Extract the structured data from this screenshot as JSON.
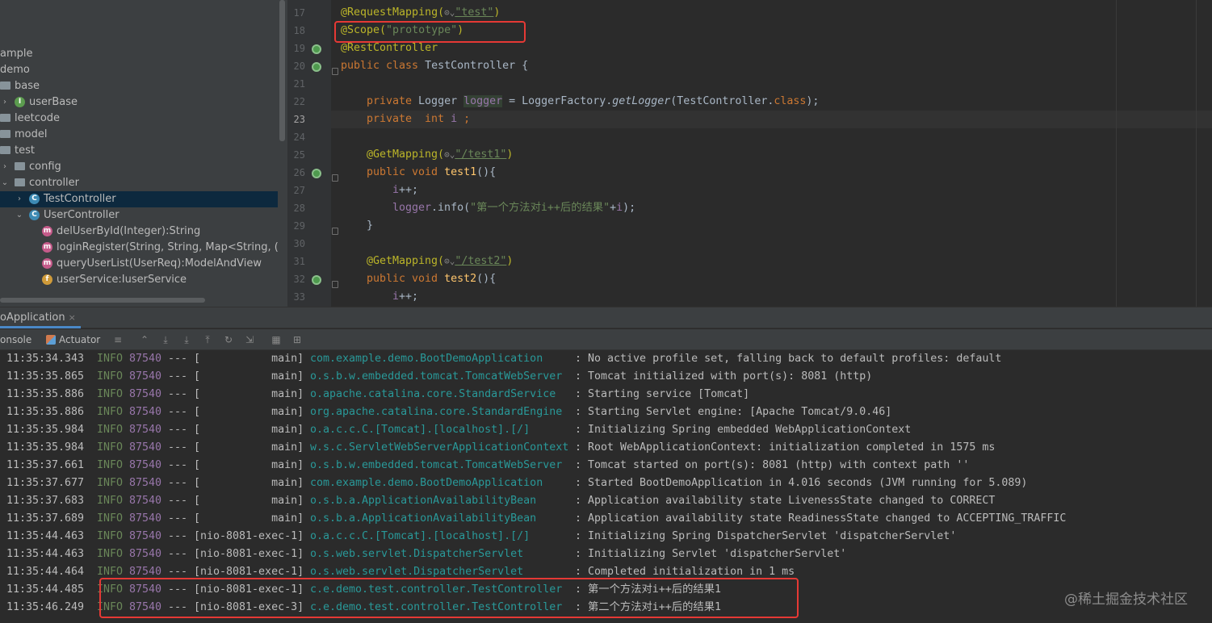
{
  "project_tree": {
    "items": [
      {
        "label": "ample",
        "icon": "none",
        "arrow": ""
      },
      {
        "label": "demo",
        "icon": "none",
        "arrow": ""
      },
      {
        "label": "base",
        "icon": "folder-icon",
        "arrow": ""
      },
      {
        "label": "userBase",
        "icon": "interface-icon",
        "arrow": "›"
      },
      {
        "label": "leetcode",
        "icon": "folder-icon",
        "arrow": ""
      },
      {
        "label": "model",
        "icon": "folder-icon",
        "arrow": ""
      },
      {
        "label": "test",
        "icon": "folder-icon",
        "arrow": ""
      },
      {
        "label": "config",
        "icon": "folder-icon",
        "arrow": "›"
      },
      {
        "label": "controller",
        "icon": "folder-icon",
        "arrow": "⌄"
      },
      {
        "label": "TestController",
        "icon": "class-icon",
        "arrow": "›"
      },
      {
        "label": "UserController",
        "icon": "class-icon",
        "arrow": "⌄"
      },
      {
        "label": "delUserById(Integer):String",
        "icon": "method-icon",
        "arrow": ""
      },
      {
        "label": "loginRegister(String, String, Map<String, (",
        "icon": "method-icon",
        "arrow": ""
      },
      {
        "label": "queryUserList(UserReq):ModelAndView",
        "icon": "method-icon",
        "arrow": ""
      },
      {
        "label": "userService:IuserService",
        "icon": "field-icon",
        "arrow": ""
      }
    ],
    "selected": "TestController"
  },
  "editor": {
    "line_numbers": [
      "17",
      "18",
      "19",
      "20",
      "21",
      "22",
      "23",
      "24",
      "25",
      "26",
      "27",
      "28",
      "29",
      "30",
      "31",
      "32",
      "33"
    ],
    "current_line": "23",
    "code": {
      "l17": {
        "a": "@RequestMapping(",
        "b": "\"test\"",
        "c": ")"
      },
      "l18": {
        "a": "@Scope(",
        "b": "\"prototype\"",
        "c": ")"
      },
      "l19": {
        "a": "@RestController"
      },
      "l20": {
        "a": "public class ",
        "b": "TestController {"
      },
      "l22": {
        "a": "private ",
        "b": "Logger ",
        "c": "logger",
        "d": " = LoggerFactory.",
        "e": "getLogger",
        "f": "(TestController.",
        "g": "class",
        "h": ");"
      },
      "l23": {
        "a": "private  int ",
        "b": "i",
        "c": " ;"
      },
      "l25": {
        "a": "@GetMapping(",
        "b": "\"/test1\"",
        "c": ")"
      },
      "l26": {
        "a": "public void ",
        "b": "test1",
        "c": "(){"
      },
      "l27": {
        "a": "i",
        "b": "++;"
      },
      "l28": {
        "a": "logger",
        "b": ".info(",
        "c": "\"第一个方法对i++后的结果\"",
        "d": "+",
        "e": "i",
        "f": ");"
      },
      "l29": {
        "a": "}"
      },
      "l31": {
        "a": "@GetMapping(",
        "b": "\"/test2\"",
        "c": ")"
      },
      "l32": {
        "a": "public void ",
        "b": "test2",
        "c": "(){"
      },
      "l33": {
        "a": "i",
        "b": "++;"
      }
    }
  },
  "run_panel": {
    "tab_label": "oApplication",
    "close_glyph": "×",
    "tabs": {
      "console": "onsole",
      "actuator": "Actuator"
    },
    "toolbar_icons": [
      "menu-icon",
      "restore-layout-icon",
      "scroll-down-icon",
      "scroll-end-icon",
      "scroll-up-icon",
      "refresh-icon",
      "filter-icon",
      "table-icon",
      "settings-icon"
    ]
  },
  "console": {
    "rows": [
      {
        "time": "11:35:34.343",
        "level": "INFO",
        "pid": "87540",
        "sep": "---",
        "thread": "[           main]",
        "logger": "com.example.demo.BootDemoApplication",
        "msg": ": No active profile set, falling back to default profiles: default"
      },
      {
        "time": "11:35:35.865",
        "level": "INFO",
        "pid": "87540",
        "sep": "---",
        "thread": "[           main]",
        "logger": "o.s.b.w.embedded.tomcat.TomcatWebServer",
        "msg": ": Tomcat initialized with port(s): 8081 (http)"
      },
      {
        "time": "11:35:35.886",
        "level": "INFO",
        "pid": "87540",
        "sep": "---",
        "thread": "[           main]",
        "logger": "o.apache.catalina.core.StandardService",
        "msg": ": Starting service [Tomcat]"
      },
      {
        "time": "11:35:35.886",
        "level": "INFO",
        "pid": "87540",
        "sep": "---",
        "thread": "[           main]",
        "logger": "org.apache.catalina.core.StandardEngine",
        "msg": ": Starting Servlet engine: [Apache Tomcat/9.0.46]"
      },
      {
        "time": "11:35:35.984",
        "level": "INFO",
        "pid": "87540",
        "sep": "---",
        "thread": "[           main]",
        "logger": "o.a.c.c.C.[Tomcat].[localhost].[/]",
        "msg": ": Initializing Spring embedded WebApplicationContext"
      },
      {
        "time": "11:35:35.984",
        "level": "INFO",
        "pid": "87540",
        "sep": "---",
        "thread": "[           main]",
        "logger": "w.s.c.ServletWebServerApplicationContext",
        "msg": ": Root WebApplicationContext: initialization completed in 1575 ms"
      },
      {
        "time": "11:35:37.661",
        "level": "INFO",
        "pid": "87540",
        "sep": "---",
        "thread": "[           main]",
        "logger": "o.s.b.w.embedded.tomcat.TomcatWebServer",
        "msg": ": Tomcat started on port(s): 8081 (http) with context path ''"
      },
      {
        "time": "11:35:37.677",
        "level": "INFO",
        "pid": "87540",
        "sep": "---",
        "thread": "[           main]",
        "logger": "com.example.demo.BootDemoApplication",
        "msg": ": Started BootDemoApplication in 4.016 seconds (JVM running for 5.089)"
      },
      {
        "time": "11:35:37.683",
        "level": "INFO",
        "pid": "87540",
        "sep": "---",
        "thread": "[           main]",
        "logger": "o.s.b.a.ApplicationAvailabilityBean",
        "msg": ": Application availability state LivenessState changed to CORRECT"
      },
      {
        "time": "11:35:37.689",
        "level": "INFO",
        "pid": "87540",
        "sep": "---",
        "thread": "[           main]",
        "logger": "o.s.b.a.ApplicationAvailabilityBean",
        "msg": ": Application availability state ReadinessState changed to ACCEPTING_TRAFFIC"
      },
      {
        "time": "11:35:44.463",
        "level": "INFO",
        "pid": "87540",
        "sep": "---",
        "thread": "[nio-8081-exec-1]",
        "logger": "o.a.c.c.C.[Tomcat].[localhost].[/]",
        "msg": ": Initializing Spring DispatcherServlet 'dispatcherServlet'"
      },
      {
        "time": "11:35:44.463",
        "level": "INFO",
        "pid": "87540",
        "sep": "---",
        "thread": "[nio-8081-exec-1]",
        "logger": "o.s.web.servlet.DispatcherServlet",
        "msg": ": Initializing Servlet 'dispatcherServlet'"
      },
      {
        "time": "11:35:44.464",
        "level": "INFO",
        "pid": "87540",
        "sep": "---",
        "thread": "[nio-8081-exec-1]",
        "logger": "o.s.web.servlet.DispatcherServlet",
        "msg": ": Completed initialization in 1 ms"
      },
      {
        "time": "11:35:44.485",
        "level": "INFO",
        "pid": "87540",
        "sep": "---",
        "thread": "[nio-8081-exec-1]",
        "logger": "c.e.demo.test.controller.TestController",
        "msg": ": 第一个方法对i++后的结果1"
      },
      {
        "time": "11:35:46.249",
        "level": "INFO",
        "pid": "87540",
        "sep": "---",
        "thread": "[nio-8081-exec-3]",
        "logger": "c.e.demo.test.controller.TestController",
        "msg": ": 第二个方法对i++后的结果1"
      }
    ]
  },
  "watermark": "@稀土掘金技术社区",
  "colors": {
    "highlight_box": "#e53935",
    "selection": "#0d293e",
    "accent_tab": "#4a88c7"
  }
}
